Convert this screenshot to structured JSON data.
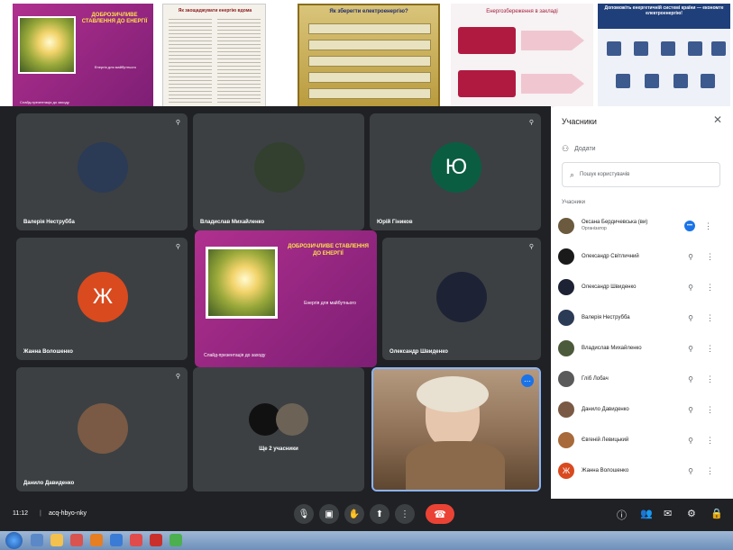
{
  "slides": {
    "s1_title": "ДОБРОЗИЧЛИВЕ СТАВЛЕННЯ ДО ЕНЕРГІЇ",
    "s1_sub": "Енергія для майбутнього",
    "s1_foot": "Слайд-презентація до заходу",
    "s2_title": "Як заощаджувати енергію вдома",
    "s3_title": "Як зберегти електроенергію?",
    "s4_title": "Енергозбереження в закладі",
    "s5_title": "Допоможіть енергетичній системі країни — економте електроенергію!"
  },
  "tiles": [
    {
      "name": "Валерія Неструбба",
      "avatar_color": "#2b3a55"
    },
    {
      "name": "Владислав Михайленко",
      "avatar_color": "#334030"
    },
    {
      "name": "Юрій Гіников",
      "avatar_letter": "Ю",
      "avatar_color": "#0b5d42"
    },
    {
      "name": "Жанна Волошенко",
      "avatar_letter": "Ж",
      "avatar_color": "#d94a1f"
    },
    {
      "name": "Олександр Швиденко",
      "avatar_color": "#1d2235"
    },
    {
      "name": "Данило Давиденко",
      "avatar_color": "#7a5a44"
    },
    {
      "name": "Ще 2 учасники"
    }
  ],
  "panel": {
    "title": "Учасники",
    "add_label": "Додати",
    "search_placeholder": "Пошук користувачів",
    "section_label": "Учасники",
    "participants": [
      {
        "name": "Оксана Бердичевська (ви)",
        "role": "Організатор",
        "color": "#6b5a3e"
      },
      {
        "name": "Олександр Світличний",
        "color": "#1a1a1a"
      },
      {
        "name": "Олександр Швиденко",
        "color": "#1d2235"
      },
      {
        "name": "Валерія Неструбба",
        "color": "#2b3a55"
      },
      {
        "name": "Владислав Михайленко",
        "color": "#4a5a3a"
      },
      {
        "name": "Гліб Лобач",
        "color": "#5a5a5a"
      },
      {
        "name": "Данило Давиденко",
        "color": "#7a5a44"
      },
      {
        "name": "Євгеній Левицький",
        "color": "#a86a3a"
      },
      {
        "name": "Жанна Волошенко",
        "color": "#d94a1f",
        "letter": "Ж"
      }
    ]
  },
  "bar": {
    "clock": "11:12",
    "separator": "|",
    "meeting_code": "acq-hbyo-nky"
  },
  "icons": {
    "mic": "mic-icon",
    "captions": "captions-icon",
    "hand": "raise-hand-icon",
    "present": "present-icon",
    "more": "more-icon",
    "end": "end-call-icon"
  }
}
